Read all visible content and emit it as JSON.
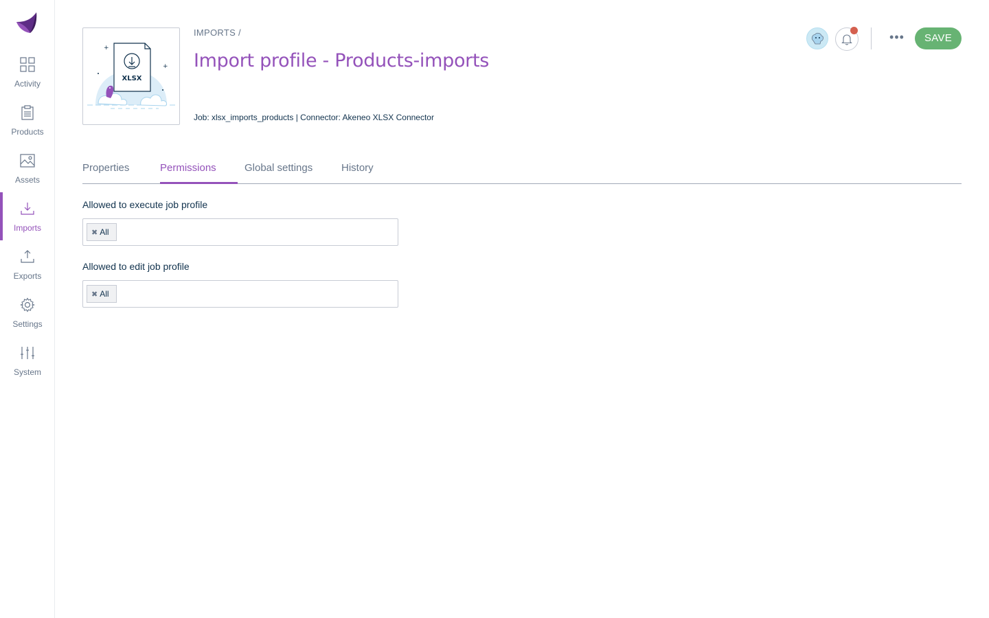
{
  "sidebar": {
    "items": [
      {
        "label": "Activity",
        "icon": "activity-icon"
      },
      {
        "label": "Products",
        "icon": "products-icon"
      },
      {
        "label": "Assets",
        "icon": "assets-icon"
      },
      {
        "label": "Imports",
        "icon": "imports-icon",
        "active": true
      },
      {
        "label": "Exports",
        "icon": "exports-icon"
      },
      {
        "label": "Settings",
        "icon": "gear-icon"
      },
      {
        "label": "System",
        "icon": "sliders-icon"
      }
    ]
  },
  "header": {
    "breadcrumb": "IMPORTS /",
    "title": "Import profile - Products-imports",
    "meta": "Job: xlsx_imports_products | Connector: Akeneo XLSX Connector",
    "illustration_label": "XLSX",
    "more_label": "•••",
    "save_label": "SAVE"
  },
  "tabs": [
    {
      "label": "Properties"
    },
    {
      "label": "Permissions",
      "active": true
    },
    {
      "label": "Global settings"
    },
    {
      "label": "History"
    }
  ],
  "permissions": {
    "execute": {
      "label": "Allowed to execute job profile",
      "tags": [
        "All"
      ]
    },
    "edit": {
      "label": "Allowed to edit job profile",
      "tags": [
        "All"
      ]
    }
  },
  "colors": {
    "accent": "#9452ba",
    "save": "#67b373",
    "notification": "#d4604f"
  }
}
